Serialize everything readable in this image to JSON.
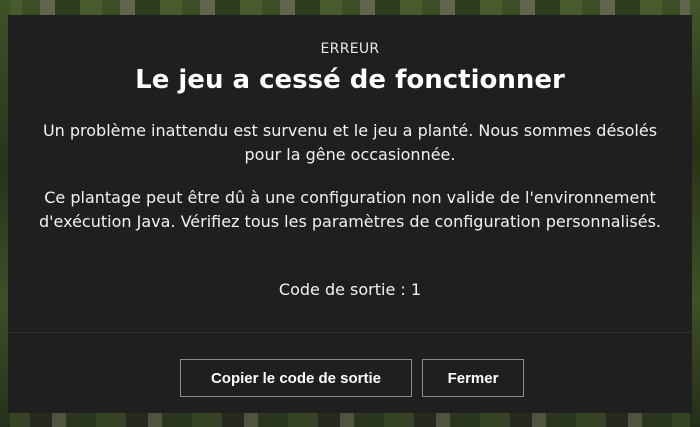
{
  "dialog": {
    "eyebrow": "ERREUR",
    "title": "Le jeu a cessé de fonctionner",
    "paragraph_1": "Un problème inattendu est survenu et le jeu a planté. Nous sommes désolés pour la gêne occasionnée.",
    "paragraph_2": "Ce plantage peut être dû à une configuration non valide de l'environnement d'exécution Java. Vérifiez tous les paramètres de configuration personnalisés.",
    "exit_code": "Code de sortie : 1"
  },
  "buttons": {
    "copy_label": "Copier le code de sortie",
    "close_label": "Fermer"
  },
  "colors": {
    "dialog_background": "#1f1f1f",
    "button_border": "#8a8a8a",
    "text": "#ffffff"
  }
}
